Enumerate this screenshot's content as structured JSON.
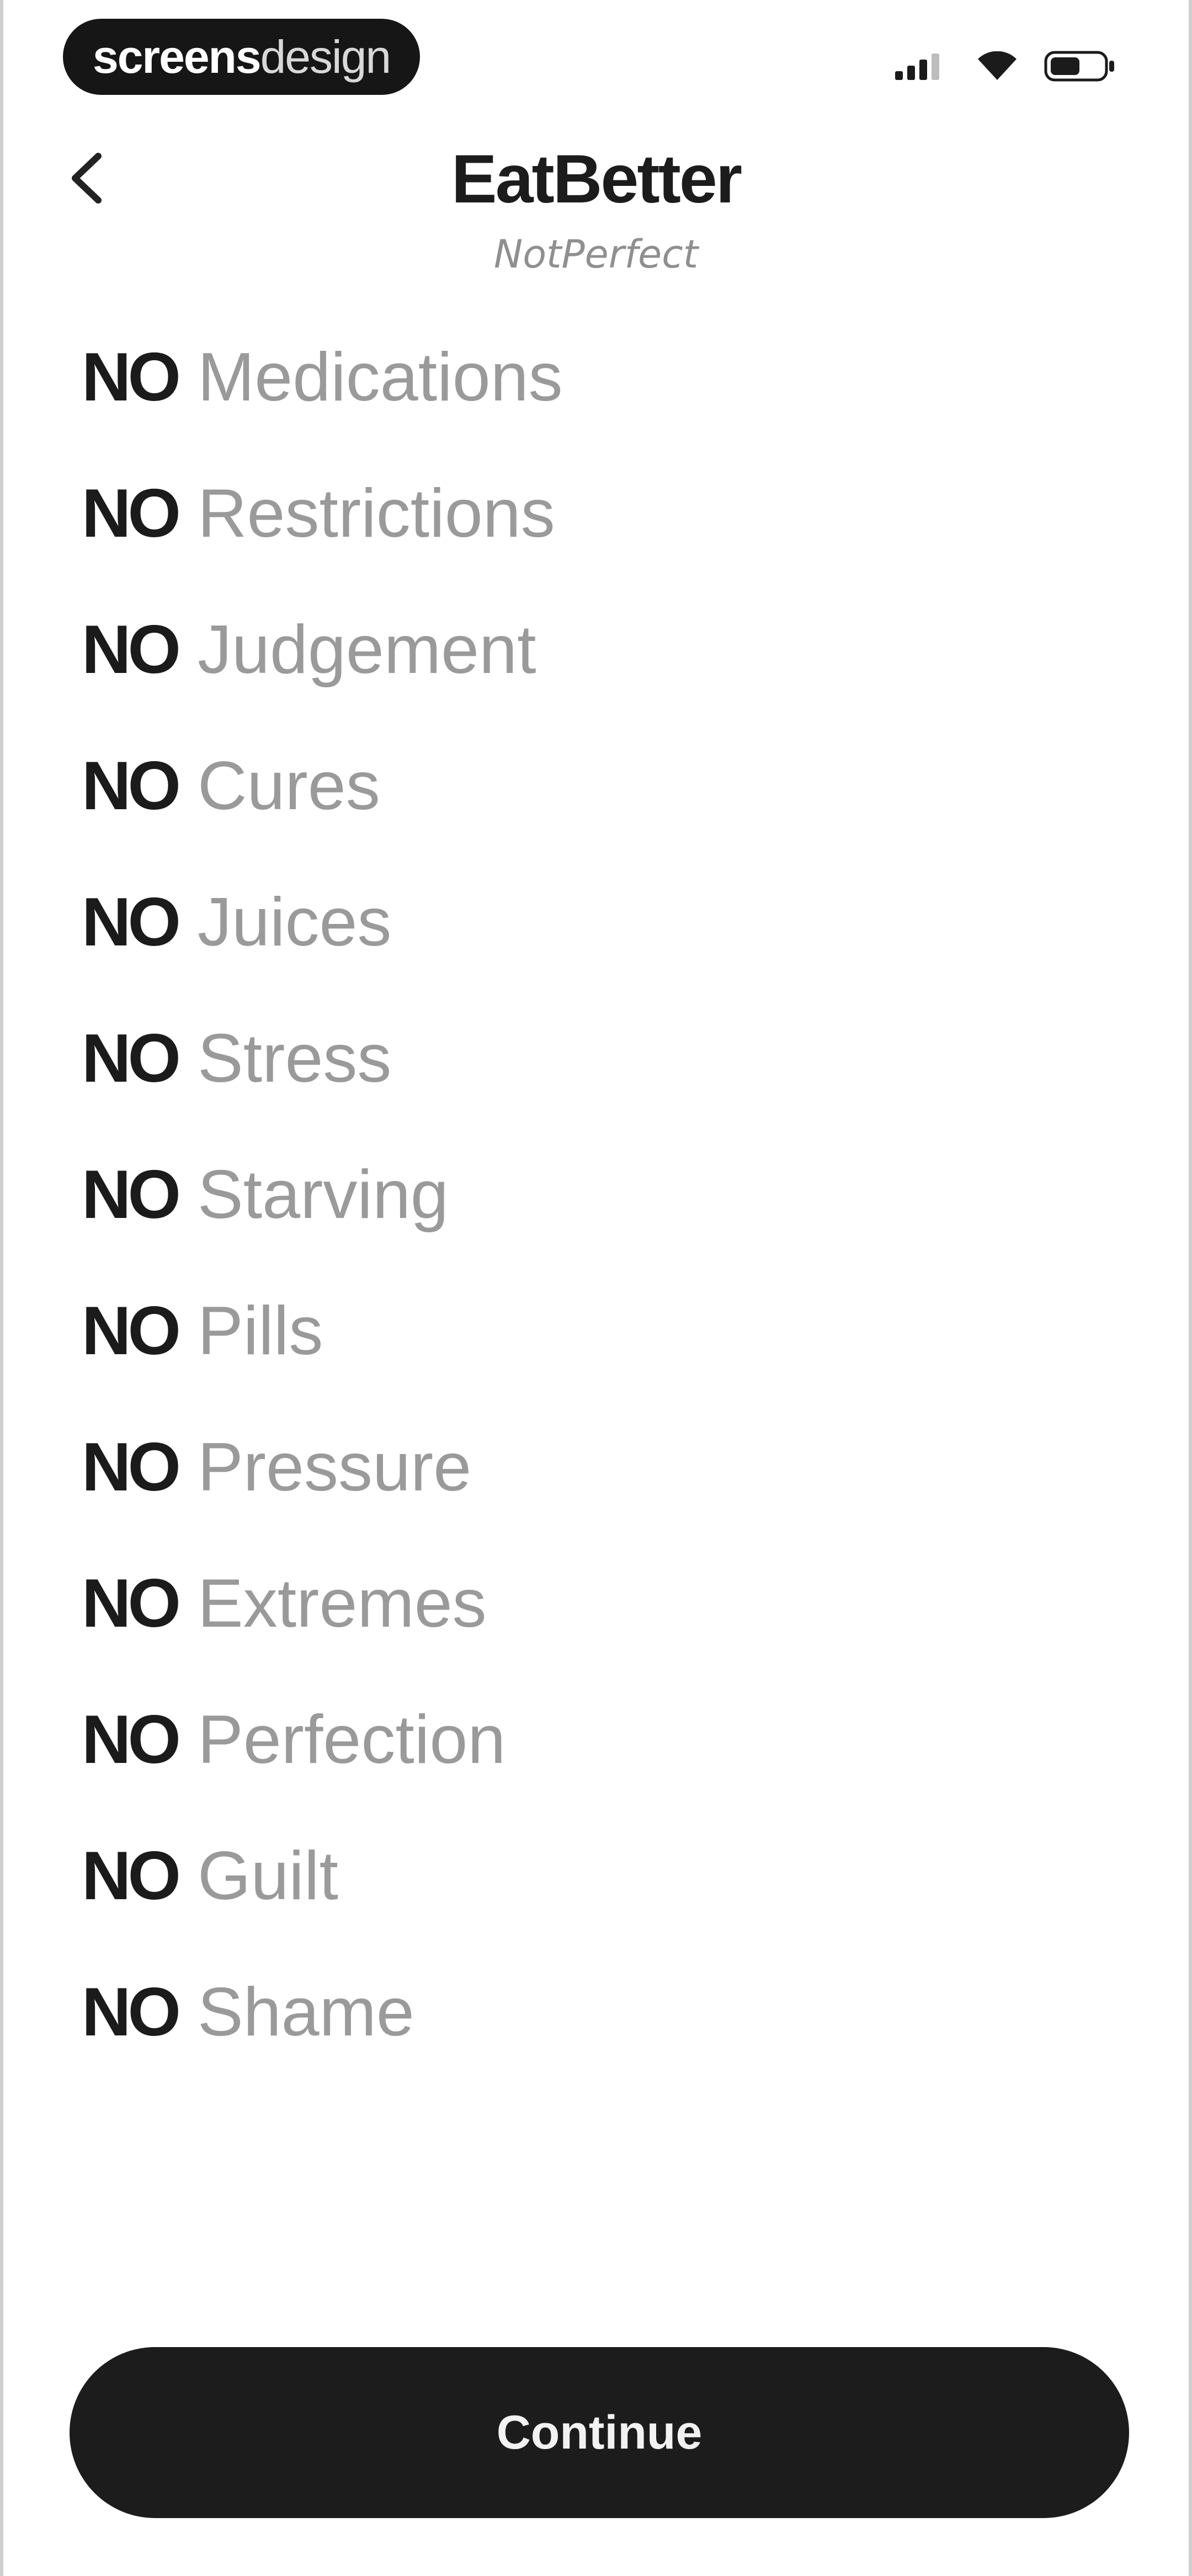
{
  "status_bar": {
    "brand_part_a": "screens",
    "brand_part_b": "design"
  },
  "header": {
    "title": "EatBetter",
    "subtitle": "NotPerfect",
    "back_icon": "chevron-left-icon"
  },
  "list": {
    "prefix": "NO",
    "items": [
      "Medications",
      "Restrictions",
      "Judgement",
      "Cures",
      "Juices",
      "Stress",
      "Starving",
      "Pills",
      "Pressure",
      "Extremes",
      "Perfection",
      "Guilt",
      "Shame"
    ]
  },
  "footer": {
    "continue_label": "Continue"
  },
  "colors": {
    "accent": "#1c1c1c",
    "muted_text": "#9a9a9a",
    "background": "#ffffff"
  }
}
